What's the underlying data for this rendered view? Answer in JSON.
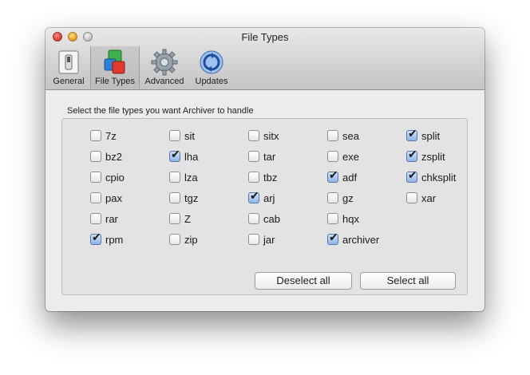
{
  "window": {
    "title": "File Types"
  },
  "toolbar": {
    "items": [
      {
        "label": "General",
        "icon": "switch-icon"
      },
      {
        "label": "File Types",
        "icon": "file-types-icon",
        "selected": true
      },
      {
        "label": "Advanced",
        "icon": "gear-icon"
      },
      {
        "label": "Updates",
        "icon": "updates-icon"
      }
    ]
  },
  "instruction": "Select the file types you want Archiver to handle",
  "file_types": [
    [
      {
        "label": "7z",
        "checked": false
      },
      {
        "label": "sit",
        "checked": false
      },
      {
        "label": "sitx",
        "checked": false
      },
      {
        "label": "sea",
        "checked": false
      },
      {
        "label": "split",
        "checked": true
      }
    ],
    [
      {
        "label": "bz2",
        "checked": false
      },
      {
        "label": "lha",
        "checked": true
      },
      {
        "label": "tar",
        "checked": false
      },
      {
        "label": "exe",
        "checked": false
      },
      {
        "label": "zsplit",
        "checked": true
      }
    ],
    [
      {
        "label": "cpio",
        "checked": false
      },
      {
        "label": "lza",
        "checked": false
      },
      {
        "label": "tbz",
        "checked": false
      },
      {
        "label": "adf",
        "checked": true
      },
      {
        "label": "chksplit",
        "checked": true
      }
    ],
    [
      {
        "label": "pax",
        "checked": false
      },
      {
        "label": "tgz",
        "checked": false
      },
      {
        "label": "arj",
        "checked": true
      },
      {
        "label": "gz",
        "checked": false
      },
      {
        "label": "xar",
        "checked": false
      }
    ],
    [
      {
        "label": "rar",
        "checked": false
      },
      {
        "label": "Z",
        "checked": false
      },
      {
        "label": "cab",
        "checked": false
      },
      {
        "label": "hqx",
        "checked": false
      }
    ],
    [
      {
        "label": "rpm",
        "checked": true
      },
      {
        "label": "zip",
        "checked": false
      },
      {
        "label": "jar",
        "checked": false
      },
      {
        "label": "archiver",
        "checked": true
      }
    ]
  ],
  "buttons": {
    "deselect_all": "Deselect all",
    "select_all": "Select all"
  },
  "colors": {
    "checked_fill": "#8fb5e6",
    "window_bg": "#ececec",
    "close": "#e0443e",
    "minimize": "#e8a52a"
  }
}
